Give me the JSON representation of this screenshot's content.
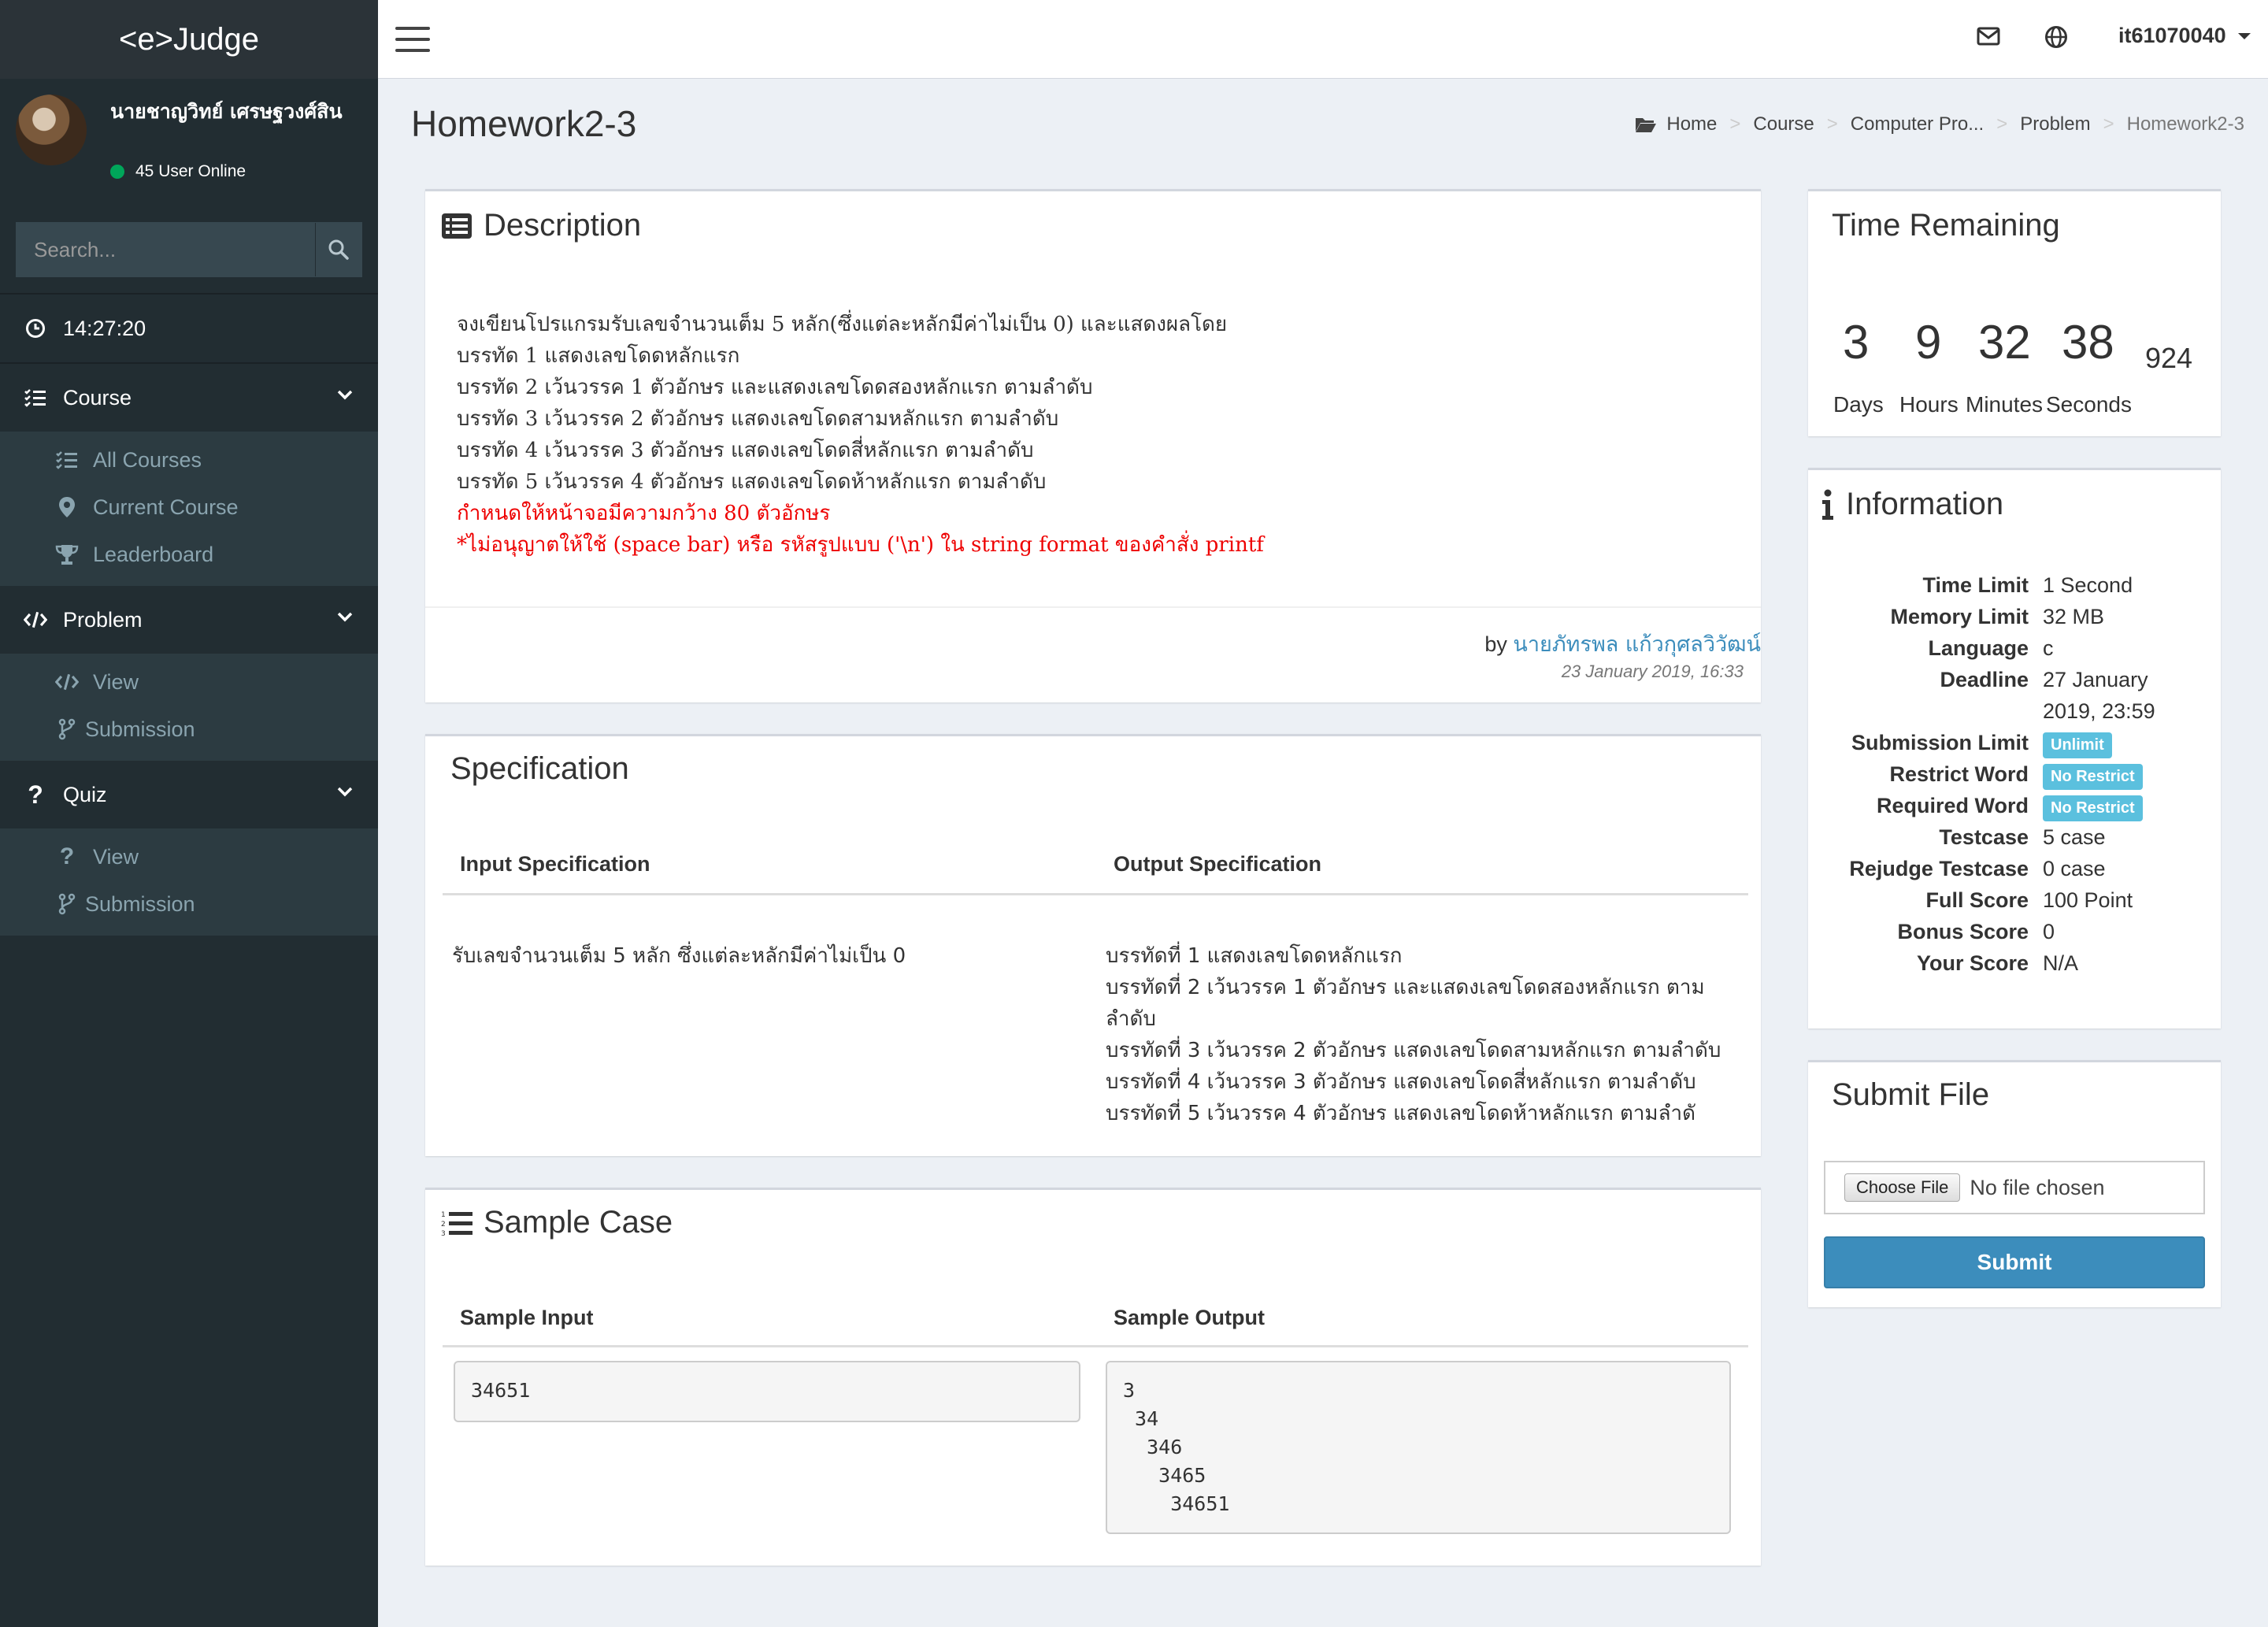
{
  "sidebar": {
    "brand": "<e>Judge",
    "user_name": "นายชาญวิทย์ เศรษฐวงศ์สิน",
    "online_status": "45 User Online",
    "search_placeholder": "Search...",
    "clock": "14:27:20",
    "menu": {
      "course_label": "Course",
      "course_items": [
        "All Courses",
        "Current Course",
        "Leaderboard"
      ],
      "problem_label": "Problem",
      "problem_items": [
        "View",
        "Submission"
      ],
      "quiz_label": "Quiz",
      "quiz_items": [
        "View",
        "Submission"
      ]
    }
  },
  "header": {
    "username": "it61070040"
  },
  "page": {
    "title": "Homework2-3",
    "breadcrumb": [
      "Home",
      "Course",
      "Computer Pro...",
      "Problem",
      "Homework2-3"
    ]
  },
  "description": {
    "title": "Description",
    "lines": [
      "จงเขียนโปรแกรมรับเลขจำนวนเต็ม 5 หลัก(ซึ่งแต่ละหลักมีค่าไม่เป็น 0) และแสดงผลโดย",
      "บรรทัด 1 แสดงเลขโดดหลักแรก",
      "บรรทัด 2 เว้นวรรค 1 ตัวอักษร และแสดงเลขโดดสองหลักแรก ตามลำดับ",
      "บรรทัด 3 เว้นวรรค 2 ตัวอักษร แสดงเลขโดดสามหลักแรก ตามลำดับ",
      "บรรทัด 4 เว้นวรรค 3 ตัวอักษร แสดงเลขโดดสี่หลักแรก ตามลำดับ",
      "บรรทัด 5 เว้นวรรค 4 ตัวอักษร แสดงเลขโดดห้าหลักแรก ตามลำดับ"
    ],
    "red_lines": [
      "กำหนดให้หน้าจอมีความกว้าง 80 ตัวอักษร",
      "*ไม่อนุญาตให้ใช้ (space bar) หรือ รหัสรูปแบบ ('\\n') ใน string format ของคำสั่ง printf"
    ],
    "by_prefix": "by",
    "author": "นายภัทรพล แก้วกุศลวิวัฒน์",
    "date": "23 January 2019, 16:33"
  },
  "specification": {
    "title": "Specification",
    "input_header": "Input Specification",
    "output_header": "Output Specification",
    "input_text": "รับเลขจำนวนเต็ม 5 หลัก ซึ่งแต่ละหลักมีค่าไม่เป็น 0",
    "output_lines": [
      "บรรทัดที่ 1 แสดงเลขโดดหลักแรก",
      "บรรทัดที่ 2 เว้นวรรค 1 ตัวอักษร และแสดงเลขโดดสองหลักแรก ตาม",
      "ลำดับ",
      "บรรทัดที่ 3 เว้นวรรค 2 ตัวอักษร แสดงเลขโดดสามหลักแรก ตามลำดับ",
      "บรรทัดที่ 4 เว้นวรรค 3 ตัวอักษร แสดงเลขโดดสี่หลักแรก ตามลำดับ",
      "บรรทัดที่ 5 เว้นวรรค 4 ตัวอักษร แสดงเลขโดดห้าหลักแรก ตามลำดั"
    ]
  },
  "sample": {
    "title": "Sample Case",
    "input_header": "Sample Input",
    "output_header": "Sample Output",
    "input": "34651",
    "output": "3\n 34\n  346\n   3465\n    34651"
  },
  "time_remaining": {
    "title": "Time Remaining",
    "days": "3",
    "hours": "9",
    "minutes": "32",
    "seconds": "38",
    "millis": "924",
    "labels": [
      "Days",
      "Hours",
      "Minutes",
      "Seconds"
    ]
  },
  "information": {
    "title": "Information",
    "rows": [
      {
        "label": "Time Limit",
        "value": "1 Second"
      },
      {
        "label": "Memory Limit",
        "value": "32 MB"
      },
      {
        "label": "Language",
        "value": "c"
      },
      {
        "label": "Deadline",
        "value": "27 January",
        "value2": "2019, 23:59"
      },
      {
        "label": "Submission Limit",
        "badge": "Unlimit"
      },
      {
        "label": "Restrict Word",
        "badge": "No Restrict"
      },
      {
        "label": "Required Word",
        "badge": "No Restrict"
      },
      {
        "label": "Testcase",
        "value": "5 case"
      },
      {
        "label": "Rejudge Testcase",
        "value": "0 case"
      },
      {
        "label": "Full Score",
        "value": "100 Point"
      },
      {
        "label": "Bonus Score",
        "value": "0"
      },
      {
        "label": "Your Score",
        "value": "N/A"
      }
    ]
  },
  "submit": {
    "title": "Submit File",
    "choose_label": "Choose File",
    "no_file": "No file chosen",
    "button": "Submit"
  },
  "colors": {
    "sidebar": "#222d32",
    "accent": "#3c8dbc",
    "badge": "#5bc0de",
    "online": "#00a65a",
    "warning_text": "#ee0000"
  }
}
